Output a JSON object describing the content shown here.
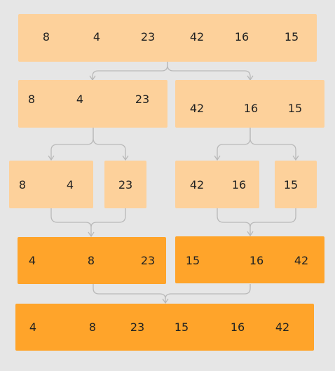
{
  "rows": {
    "row1": [
      [
        "8",
        "4",
        "23",
        "42",
        "16",
        "15"
      ]
    ],
    "row2": [
      [
        "8",
        "4",
        "23"
      ],
      [
        "42",
        "16",
        "15"
      ]
    ],
    "row3": [
      [
        "8",
        "4"
      ],
      [
        "23"
      ],
      [
        "42",
        "16"
      ],
      [
        "15"
      ]
    ],
    "row4": [
      [
        "4",
        "8",
        "23"
      ],
      [
        "15",
        "16",
        "42"
      ]
    ],
    "row5": [
      [
        "4",
        "8",
        "23",
        "15",
        "16",
        "42"
      ]
    ]
  },
  "colors": {
    "background": "#e6e6e6",
    "unsorted_box": "#fdd19b",
    "sorted_box": "#ffa42a",
    "connector": "#b9b9b9"
  }
}
